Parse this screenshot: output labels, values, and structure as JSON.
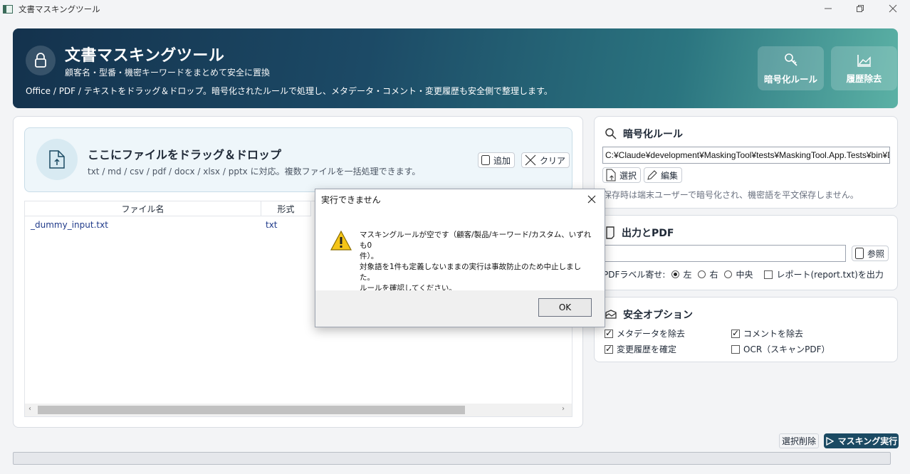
{
  "window": {
    "title": "文書マスキングツール"
  },
  "header": {
    "title": "文書マスキングツール",
    "subtitle": "顧客名・型番・機密キーワードをまとめて安全に置換",
    "description": "Office / PDF / テキストをドラッグ＆ドロップ。暗号化されたルールで処理し、メタデータ・コメント・変更履歴も安全側で整理します。",
    "buttons": {
      "rules": "暗号化ルール",
      "history": "履歴除去"
    }
  },
  "dropzone": {
    "title": "ここにファイルをドラッグ＆ドロップ",
    "hint": "txt / md / csv / pdf / docx / xlsx / pptx に対応。複数ファイルを一括処理できます。",
    "add_label": "追加",
    "clear_label": "クリア"
  },
  "file_table": {
    "columns": [
      "ファイル名",
      "形式"
    ],
    "rows": [
      {
        "name": "_dummy_input.txt",
        "type": "txt"
      }
    ]
  },
  "rules_section": {
    "title": "暗号化ルール",
    "path": "C:¥Claude¥development¥MaskingTool¥tests¥MaskingTool.App.Tests¥bin¥Debug",
    "select_label": "選択",
    "edit_label": "編集",
    "note": "保存時は端末ユーザーで暗号化され、機密語を平文保存しません。"
  },
  "output_section": {
    "title": "出力とPDF",
    "output_path": "",
    "browse_label": "参照",
    "pdf_label_align": "PDFラベル寄せ:",
    "align_options": [
      {
        "label": "左",
        "selected": true
      },
      {
        "label": "右",
        "selected": false
      },
      {
        "label": "中央",
        "selected": false
      }
    ],
    "report_label": "レポート(report.txt)を出力",
    "report_checked": false
  },
  "safety_section": {
    "title": "安全オプション",
    "options": {
      "metadata": {
        "label": "メタデータを除去",
        "checked": true
      },
      "comments": {
        "label": "コメントを除去",
        "checked": true
      },
      "revisions": {
        "label": "変更履歴を確定",
        "checked": true
      },
      "ocr": {
        "label": "OCR（スキャンPDF）",
        "checked": false
      }
    }
  },
  "footer": {
    "delete_selected": "選択削除",
    "run": "マスキング実行",
    "progress_percent": 0
  },
  "dialog": {
    "title": "実行できません",
    "line1": "マスキングルールが空です（顧客/製品/キーワード/カスタム、いずれも0",
    "line2": "件）。",
    "line3": "対象語を1件も定義しないままの実行は事故防止のため中止しました。",
    "line4": "ルールを確認してください。",
    "ok_label": "OK"
  },
  "colors": {
    "banner_start": "#14324d",
    "banner_end": "#5bb1a5",
    "run_button": "#1b4a63"
  }
}
